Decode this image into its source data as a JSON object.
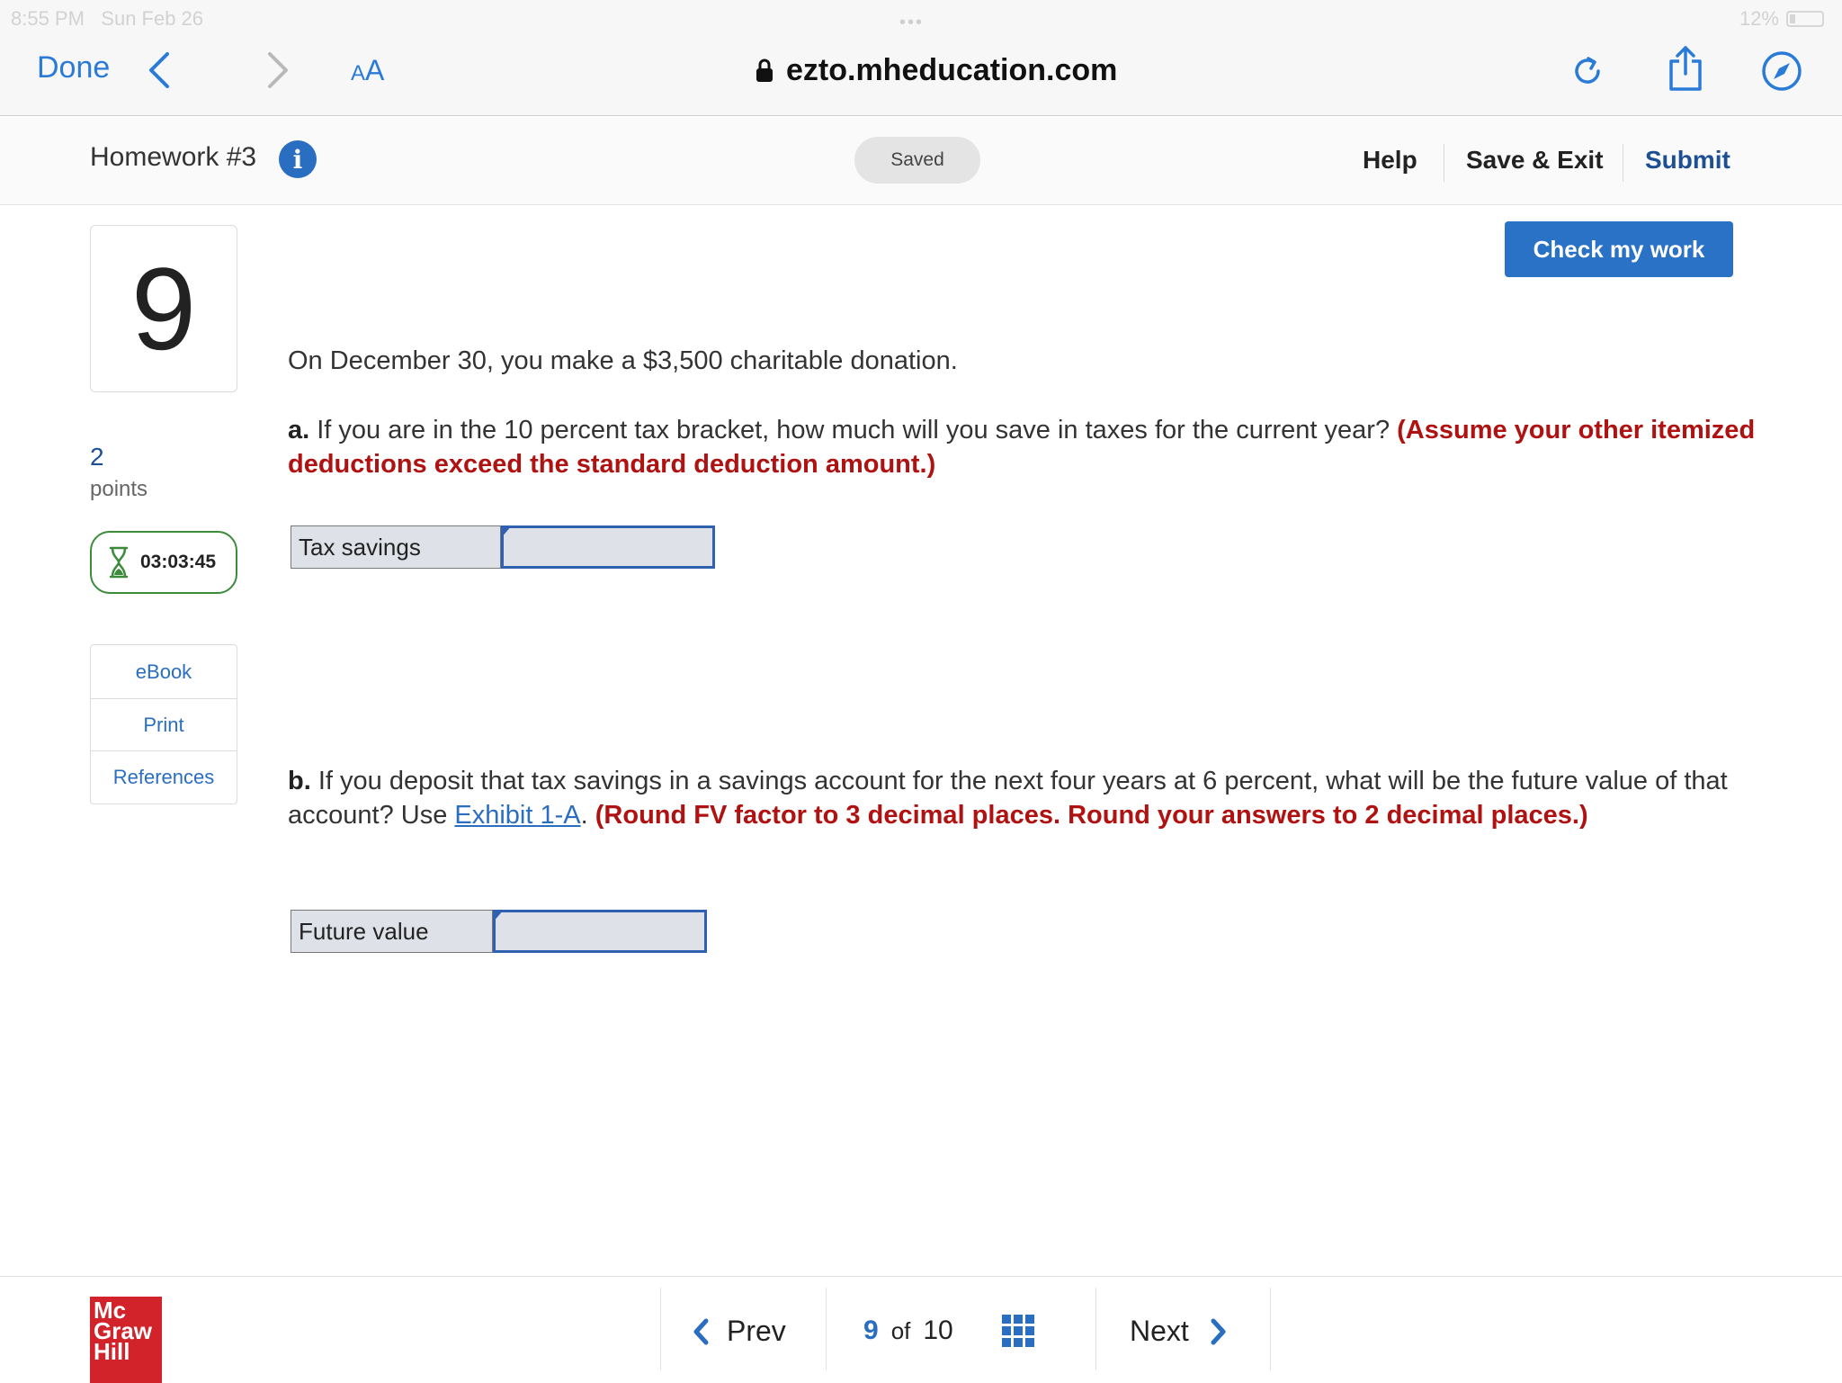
{
  "status_bar": {
    "time": "8:55 PM",
    "date": "Sun Feb 26",
    "battery": "12%"
  },
  "browser": {
    "done_label": "Done",
    "text_size_small": "A",
    "text_size_large": "A",
    "url": "ezto.mheducation.com"
  },
  "header": {
    "title": "Homework #3",
    "info_glyph": "i",
    "saved": "Saved",
    "help": "Help",
    "save_exit": "Save & Exit",
    "submit": "Submit"
  },
  "sidebar": {
    "question_number": "9",
    "points_value": "2",
    "points_label": "points",
    "timer": "03:03:45",
    "menu": [
      "eBook",
      "Print",
      "References"
    ]
  },
  "main": {
    "check_button": "Check my work",
    "intro": "On December 30, you make a $3,500 charitable donation.",
    "part_a": {
      "letter": "a.",
      "text": " If you are in the 10 percent tax bracket, how much will you save in taxes for the current year? ",
      "instruction": "(Assume your other itemized deductions exceed the standard deduction amount.)",
      "answer_label": "Tax savings",
      "answer_value": ""
    },
    "part_b": {
      "letter": "b.",
      "text": " If you deposit that tax savings in a savings account for the next four years at 6 percent, what will be the future value of that account? Use ",
      "link": "Exhibit 1-A",
      "after_link": ". ",
      "instruction": "(Round FV factor to 3 decimal places.  Round your answers to 2 decimal places.)",
      "answer_label": "Future value",
      "answer_value": ""
    }
  },
  "footer": {
    "logo_lines": [
      "Mc",
      "Graw",
      "Hill"
    ],
    "prev": "Prev",
    "current_page": "9",
    "of_label": "of",
    "total_pages": "10",
    "next": "Next"
  },
  "colors": {
    "accent": "#2a72c6",
    "instruction_red": "#b01212",
    "timer_green": "#3b8b3b",
    "logo_red": "#d2222a"
  }
}
